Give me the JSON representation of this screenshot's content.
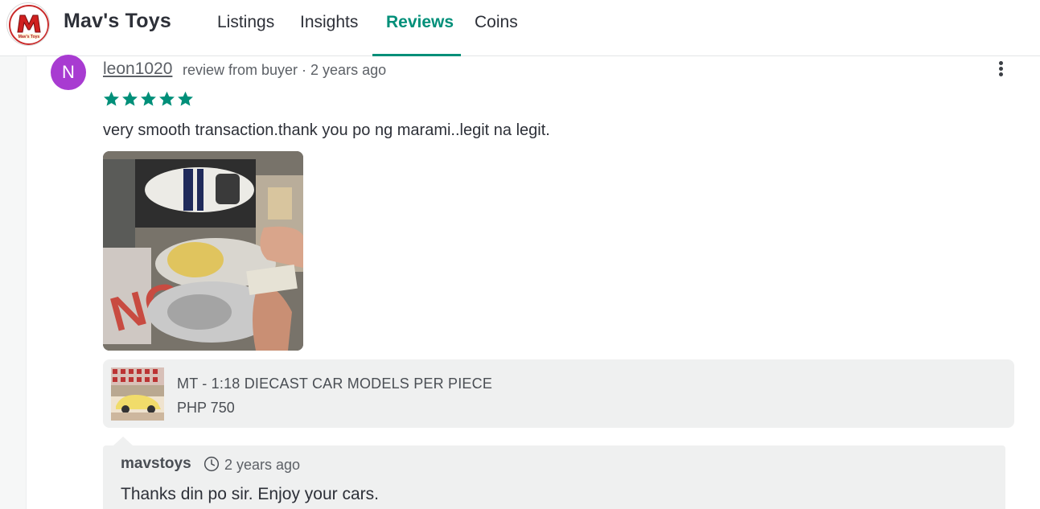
{
  "header": {
    "shop_name": "Mav's Toys",
    "logo_text": "M",
    "logo_subtext": "Mav's Toys",
    "tabs": [
      {
        "label": "Listings"
      },
      {
        "label": "Insights"
      },
      {
        "label": "Reviews",
        "active": true
      },
      {
        "label": "Coins"
      }
    ]
  },
  "review": {
    "avatar_initial": "N",
    "avatar_color": "#a83bd1",
    "reviewer": "leon1020",
    "meta": "review from buyer · 2 years ago",
    "rating": 5,
    "star_color": "#008f79",
    "text": "very smooth transaction.thank you po ng marami..legit na legit.",
    "product": {
      "title": "MT - 1:18 DIECAST CAR MODELS PER PIECE",
      "price": "PHP 750"
    },
    "reply": {
      "author": "mavstoys",
      "time": "2 years ago",
      "text": "Thanks din po sir. Enjoy your cars."
    }
  },
  "colors": {
    "accent": "#008f79",
    "text": "#2d3038",
    "muted": "#5c6066"
  }
}
